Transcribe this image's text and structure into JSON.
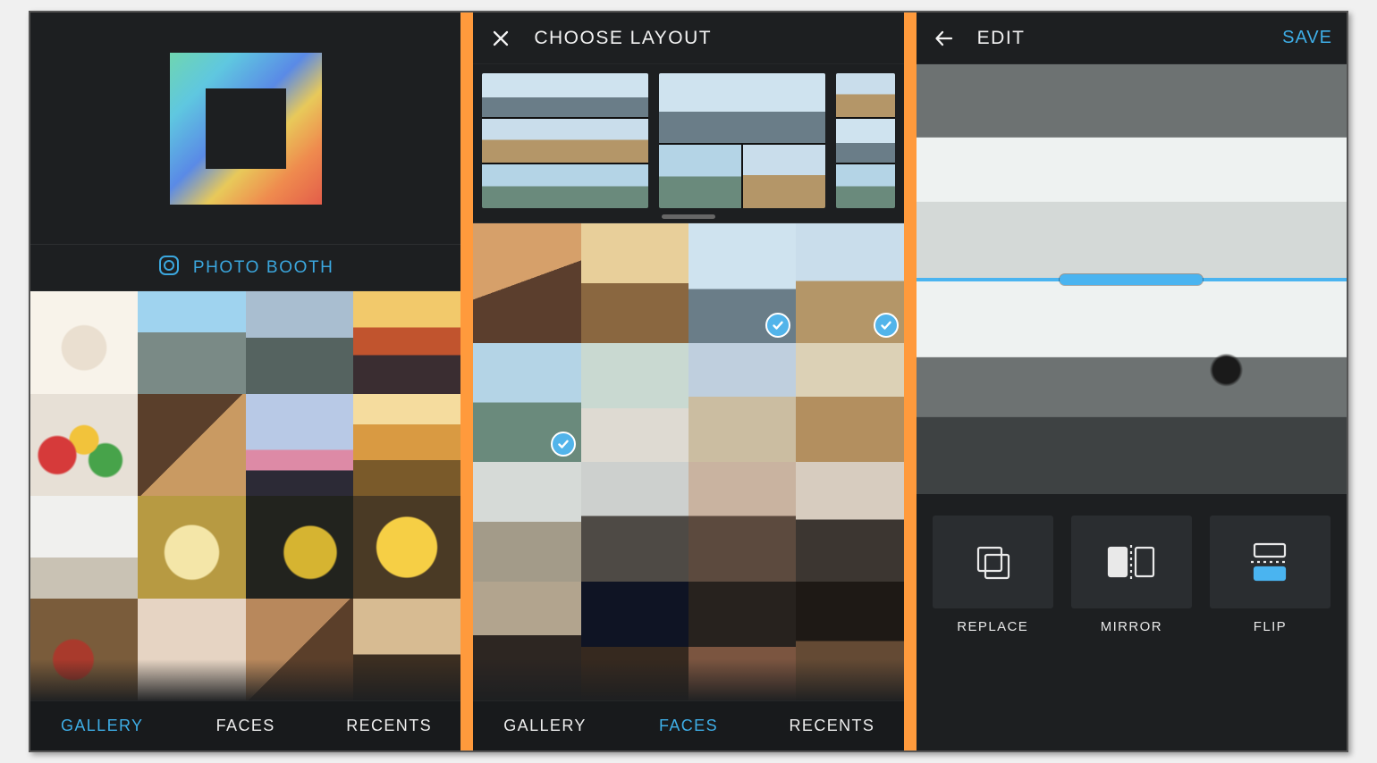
{
  "colors": {
    "accent": "#3eaee7",
    "separator": "#ff9a3c",
    "bg": "#1d1f21"
  },
  "home": {
    "photo_booth_label": "PHOTO BOOTH",
    "tabs": [
      {
        "label": "GALLERY",
        "active": true
      },
      {
        "label": "FACES",
        "active": false
      },
      {
        "label": "RECENTS",
        "active": false
      }
    ],
    "gallery_thumbs": [
      "ph1",
      "ph2",
      "ph3",
      "ph4",
      "ph5",
      "ph6",
      "ph7",
      "ph8",
      "ph9",
      "ph10",
      "ph11",
      "ph12",
      "ph13",
      "ph14",
      "ph15",
      "ph16"
    ]
  },
  "choose": {
    "title": "CHOOSE LAYOUT",
    "tabs": [
      {
        "label": "GALLERY",
        "active": false
      },
      {
        "label": "FACES",
        "active": true
      },
      {
        "label": "RECENTS",
        "active": false
      }
    ],
    "layout_options": [
      {
        "rows": 3,
        "cols": 1,
        "visible_full": true
      },
      {
        "rows": 2,
        "cols": 2,
        "visible_full": true
      },
      {
        "rows": 3,
        "cols": 1,
        "visible_full": false
      }
    ],
    "faces_thumbs": [
      {
        "cls": "pf1",
        "selected": false
      },
      {
        "cls": "pf2",
        "selected": false
      },
      {
        "cls": "pf3",
        "selected": true
      },
      {
        "cls": "pf4",
        "selected": true
      },
      {
        "cls": "pf5",
        "selected": true
      },
      {
        "cls": "pf6",
        "selected": false
      },
      {
        "cls": "pf7",
        "selected": false
      },
      {
        "cls": "pf8",
        "selected": false
      },
      {
        "cls": "pf9",
        "selected": false
      },
      {
        "cls": "pf10",
        "selected": false
      },
      {
        "cls": "pf11",
        "selected": false
      },
      {
        "cls": "pf12",
        "selected": false
      },
      {
        "cls": "pf13",
        "selected": false
      },
      {
        "cls": "pf14",
        "selected": false
      },
      {
        "cls": "pf15",
        "selected": false
      },
      {
        "cls": "pf16",
        "selected": false
      }
    ]
  },
  "edit": {
    "title": "EDIT",
    "save_label": "SAVE",
    "panes": [
      {
        "cls": "mnt-top",
        "selected": false
      },
      {
        "cls": "mnt-bot",
        "selected": true
      }
    ],
    "tools": [
      {
        "key": "replace",
        "label": "REPLACE"
      },
      {
        "key": "mirror",
        "label": "MIRROR"
      },
      {
        "key": "flip",
        "label": "FLIP"
      }
    ]
  }
}
